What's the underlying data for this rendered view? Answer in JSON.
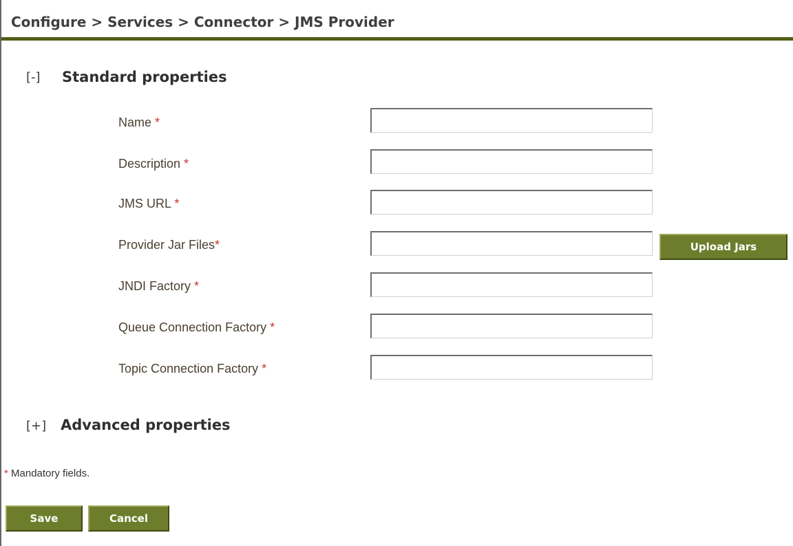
{
  "breadcrumb": "Configure > Services > Connector > JMS Provider",
  "standard_section": {
    "toggle": "[-]",
    "title": "Standard properties"
  },
  "fields": [
    {
      "label": "Name ",
      "required_mark": "*",
      "value": ""
    },
    {
      "label": "Description ",
      "required_mark": "*",
      "value": ""
    },
    {
      "label": "JMS URL ",
      "required_mark": "*",
      "value": ""
    },
    {
      "label": "Provider Jar Files",
      "required_mark": "*",
      "value": ""
    },
    {
      "label": "JNDI Factory ",
      "required_mark": "*",
      "value": ""
    },
    {
      "label": "Queue Connection Factory ",
      "required_mark": "*",
      "value": ""
    },
    {
      "label": "Topic Connection Factory ",
      "required_mark": "*",
      "value": ""
    }
  ],
  "upload_button_label": "Upload Jars",
  "advanced_section": {
    "toggle": "[+]",
    "title": "Advanced properties"
  },
  "mandatory_note": {
    "mark": "*",
    "text": " Mandatory fields."
  },
  "actions": {
    "save_label": "Save",
    "cancel_label": "Cancel"
  },
  "colors": {
    "header_rule": "#4f5f16",
    "button_bg": "#6d7d2c",
    "required_mark": "#cc3333"
  }
}
